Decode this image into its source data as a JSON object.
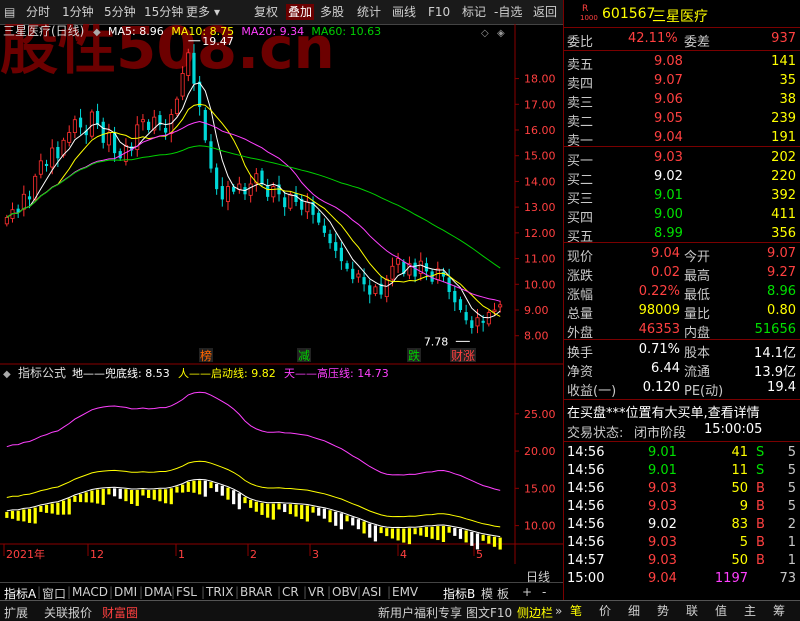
{
  "toolbar": {
    "items": [
      "分时",
      "1分钟",
      "5分钟",
      "15分钟",
      "更多",
      "复权",
      "叠加",
      "多股",
      "统计",
      "画线",
      "F10",
      "标记",
      "-自选",
      "返回"
    ],
    "active": "叠加"
  },
  "watermark": "股性508.cn",
  "main_chart": {
    "title": "三星医疗(日线)",
    "legend": [
      {
        "name": "MA5",
        "value": "8.96",
        "color": "#ffffff"
      },
      {
        "name": "MA10",
        "value": "8.75",
        "color": "#ffff00"
      },
      {
        "name": "MA20",
        "value": "9.34",
        "color": "#ff40ff"
      },
      {
        "name": "MA60",
        "value": "10.63",
        "color": "#00d000"
      }
    ],
    "high_label": "19.47",
    "low_label": "7.78",
    "markers": [
      {
        "text": "榜",
        "color": "#ff6600"
      },
      {
        "text": "减",
        "color": "#00d000"
      },
      {
        "text": "跌",
        "color": "#00d000"
      },
      {
        "text": "财涨",
        "color": "#ff4040"
      }
    ]
  },
  "chart_data": [
    {
      "type": "candlestick",
      "title": "三星医疗(日线)",
      "y_ticks": [
        "18.00",
        "17.00",
        "16.00",
        "15.00",
        "14.00",
        "13.00",
        "12.00",
        "11.00",
        "10.00",
        "9.00",
        "8.00"
      ],
      "ylim": [
        7.6,
        19.5
      ],
      "x_ticks": [
        "2021年",
        "12",
        "1",
        "2",
        "3",
        "4",
        "5"
      ],
      "close": [
        12.6,
        12.9,
        12.8,
        13.5,
        13.3,
        14.2,
        14.8,
        14.6,
        15.3,
        14.9,
        15.6,
        15.9,
        16.4,
        16.1,
        15.8,
        16.7,
        16.2,
        15.5,
        15.9,
        15.1,
        14.9,
        15.4,
        15.2,
        16.2,
        16.4,
        16.0,
        16.5,
        16.2,
        15.9,
        16.6,
        17.2,
        18.2,
        19.0,
        17.8,
        16.9,
        15.6,
        14.5,
        13.7,
        13.3,
        13.8,
        13.6,
        13.9,
        13.5,
        13.9,
        14.3,
        13.9,
        13.4,
        13.8,
        13.5,
        13.0,
        13.5,
        13.2,
        12.9,
        13.2,
        12.7,
        12.4,
        12.0,
        11.6,
        11.3,
        10.9,
        10.6,
        10.2,
        10.4,
        10.0,
        9.6,
        9.9,
        9.6,
        10.2,
        10.7,
        11.0,
        10.4,
        10.8,
        10.3,
        10.9,
        10.5,
        10.1,
        10.6,
        10.3,
        9.7,
        9.3,
        9.0,
        8.6,
        8.3,
        8.7,
        8.5,
        8.9,
        9.0,
        9.2
      ],
      "series": [
        {
          "name": "MA5",
          "last": 8.96
        },
        {
          "name": "MA10",
          "last": 8.75
        },
        {
          "name": "MA20",
          "last": 9.34
        },
        {
          "name": "MA60",
          "last": 10.63
        }
      ]
    },
    {
      "type": "line",
      "title": "指标公式",
      "y_ticks": [
        "25.00",
        "20.00",
        "15.00",
        "10.00"
      ],
      "ylim": [
        7.8,
        29
      ],
      "series": [
        {
          "name": "地——兜底线",
          "last": 8.53,
          "color": "#ffffff"
        },
        {
          "name": "人——启动线",
          "last": 9.82,
          "color": "#ffff00"
        },
        {
          "name": "天——高压线",
          "last": 14.73,
          "color": "#ff40ff"
        }
      ]
    }
  ],
  "indicator": {
    "label": "指标公式",
    "lines": [
      {
        "name": "地——兜底线:",
        "value": "8.53",
        "color": "#ffffff"
      },
      {
        "name": "人——启动线:",
        "value": "9.82",
        "color": "#ffff00"
      },
      {
        "name": "天——高压线:",
        "value": "14.73",
        "color": "#ff40ff"
      }
    ]
  },
  "bottom_tabs": [
    "指标A",
    "窗口",
    "MACD",
    "DMI",
    "DMA",
    "FSL",
    "TRIX",
    "BRAR",
    "CR",
    "VR",
    "OBV",
    "ASI",
    "EMV",
    "指标B",
    "模",
    "板",
    "+",
    "-",
    "日线"
  ],
  "status_bar": {
    "left": [
      "扩展",
      "关联报价",
      "财富圈"
    ],
    "right": [
      "新用户福利专享",
      "图文F10",
      "侧边栏"
    ],
    "icons": [
      "笔",
      "价",
      "细",
      "势",
      "联",
      "值",
      "主",
      "筹"
    ]
  },
  "quote": {
    "code": "601567",
    "name": "三星医疗",
    "badge_top": "R",
    "badge_bottom": "1000",
    "weibi_label": "委比",
    "weibi": "42.11%",
    "weicha_label": "委差",
    "weicha": "937",
    "asks": [
      {
        "label": "卖五",
        "price": "9.08",
        "vol": "141"
      },
      {
        "label": "卖四",
        "price": "9.07",
        "vol": "35"
      },
      {
        "label": "卖三",
        "price": "9.06",
        "vol": "38"
      },
      {
        "label": "卖二",
        "price": "9.05",
        "vol": "239"
      },
      {
        "label": "卖一",
        "price": "9.04",
        "vol": "191"
      }
    ],
    "bids": [
      {
        "label": "买一",
        "price": "9.03",
        "vol": "202",
        "color": "red"
      },
      {
        "label": "买二",
        "price": "9.02",
        "vol": "220",
        "color": "white"
      },
      {
        "label": "买三",
        "price": "9.01",
        "vol": "392",
        "color": "green"
      },
      {
        "label": "买四",
        "price": "9.00",
        "vol": "411",
        "color": "green"
      },
      {
        "label": "买五",
        "price": "8.99",
        "vol": "356",
        "color": "green"
      }
    ],
    "stats": [
      {
        "l1": "现价",
        "v1": "9.04",
        "c1": "red",
        "l2": "今开",
        "v2": "9.07",
        "c2": "red"
      },
      {
        "l1": "涨跌",
        "v1": "0.02",
        "c1": "red",
        "l2": "最高",
        "v2": "9.27",
        "c2": "red"
      },
      {
        "l1": "涨幅",
        "v1": "0.22%",
        "c1": "red",
        "l2": "最低",
        "v2": "8.96",
        "c2": "green"
      },
      {
        "l1": "总量",
        "v1": "98009",
        "c1": "yellow",
        "l2": "量比",
        "v2": "0.80",
        "c2": "yellow"
      },
      {
        "l1": "外盘",
        "v1": "46353",
        "c1": "red",
        "l2": "内盘",
        "v2": "51656",
        "c2": "green"
      }
    ],
    "fundamentals": [
      {
        "l1": "换手",
        "v1": "0.71%",
        "l2": "股本",
        "v2": "14.1亿"
      },
      {
        "l1": "净资",
        "v1": "6.44",
        "l2": "流通",
        "v2": "13.9亿"
      },
      {
        "l1": "收益(一)",
        "v1": "0.120",
        "l2": "PE(动)",
        "v2": "19.4"
      }
    ],
    "notice": "在买盘***位置有大买单,查看详情",
    "trade_state_label": "交易状态:",
    "trade_state": "闭市阶段",
    "trade_time": "15:00:05",
    "ticks": [
      {
        "time": "14:56",
        "price": "9.01",
        "pc": "green",
        "vol": "41",
        "bs": "S",
        "bc": "green",
        "n": "5"
      },
      {
        "time": "14:56",
        "price": "9.01",
        "pc": "green",
        "vol": "11",
        "bs": "S",
        "bc": "green",
        "n": "5"
      },
      {
        "time": "14:56",
        "price": "9.03",
        "pc": "red",
        "vol": "50",
        "bs": "B",
        "bc": "red",
        "n": "5"
      },
      {
        "time": "14:56",
        "price": "9.03",
        "pc": "red",
        "vol": "9",
        "bs": "B",
        "bc": "red",
        "n": "5"
      },
      {
        "time": "14:56",
        "price": "9.02",
        "pc": "white",
        "vol": "83",
        "bs": "B",
        "bc": "red",
        "n": "2"
      },
      {
        "time": "14:56",
        "price": "9.03",
        "pc": "red",
        "vol": "5",
        "bs": "B",
        "bc": "red",
        "n": "1"
      },
      {
        "time": "14:57",
        "price": "9.03",
        "pc": "red",
        "vol": "50",
        "bs": "B",
        "bc": "red",
        "n": "1"
      },
      {
        "time": "15:00",
        "price": "9.04",
        "pc": "red",
        "vol": "1197",
        "bs": "",
        "bc": "red",
        "n": "73"
      }
    ]
  }
}
